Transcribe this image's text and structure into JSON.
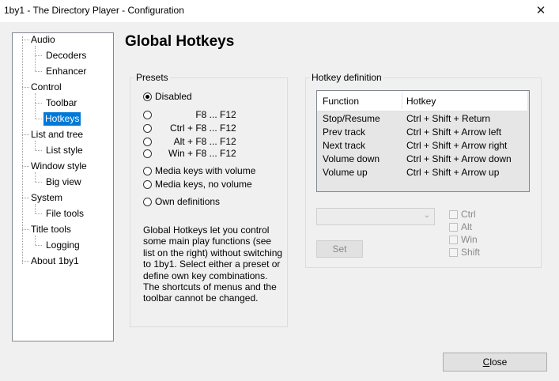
{
  "window": {
    "title": "1by1 - The Directory Player - Configuration",
    "close_glyph": "✕"
  },
  "tree": {
    "items": [
      {
        "label": "Audio"
      },
      {
        "label": "Decoders"
      },
      {
        "label": "Enhancer"
      },
      {
        "label": "Control"
      },
      {
        "label": "Toolbar"
      },
      {
        "label": "Hotkeys",
        "selected": true
      },
      {
        "label": "List and tree"
      },
      {
        "label": "List style"
      },
      {
        "label": "Window style"
      },
      {
        "label": "Big view"
      },
      {
        "label": "System"
      },
      {
        "label": "File tools"
      },
      {
        "label": "Title tools"
      },
      {
        "label": "Logging"
      },
      {
        "label": "About 1by1"
      }
    ]
  },
  "page": {
    "title": "Global Hotkeys"
  },
  "presets": {
    "label": "Presets",
    "options": [
      {
        "prefix": "",
        "label": "Disabled",
        "selected": true
      },
      {
        "prefix": "",
        "label": "F8 ... F12"
      },
      {
        "prefix": "Ctrl +",
        "label": "F8 ... F12"
      },
      {
        "prefix": "Alt +",
        "label": "F8 ... F12"
      },
      {
        "prefix": "Win +",
        "label": "F8 ... F12"
      },
      {
        "prefix": "",
        "label": "Media keys with volume"
      },
      {
        "prefix": "",
        "label": "Media keys, no volume"
      },
      {
        "prefix": "",
        "label": "Own definitions"
      }
    ],
    "description": "Global Hotkeys let you control some main play functions (see list on the right) without switching to 1by1. Select either a preset or define own key combinations. The shortcuts of menus and the toolbar cannot be changed."
  },
  "hotkey_definition": {
    "label": "Hotkey definition",
    "columns": {
      "function": "Function",
      "hotkey": "Hotkey"
    },
    "rows": [
      {
        "function": "Stop/Resume",
        "hotkey": "Ctrl + Shift + Return"
      },
      {
        "function": "Prev track",
        "hotkey": "Ctrl + Shift + Arrow left"
      },
      {
        "function": "Next track",
        "hotkey": "Ctrl + Shift + Arrow right"
      },
      {
        "function": "Volume down",
        "hotkey": "Ctrl + Shift + Arrow down"
      },
      {
        "function": "Volume up",
        "hotkey": "Ctrl + Shift + Arrow up"
      }
    ],
    "key_select_value": "",
    "set_label": "Set",
    "modifiers": [
      "Ctrl",
      "Alt",
      "Win",
      "Shift"
    ]
  },
  "footer": {
    "close_label_mnemonic": "C",
    "close_label_rest": "lose"
  }
}
